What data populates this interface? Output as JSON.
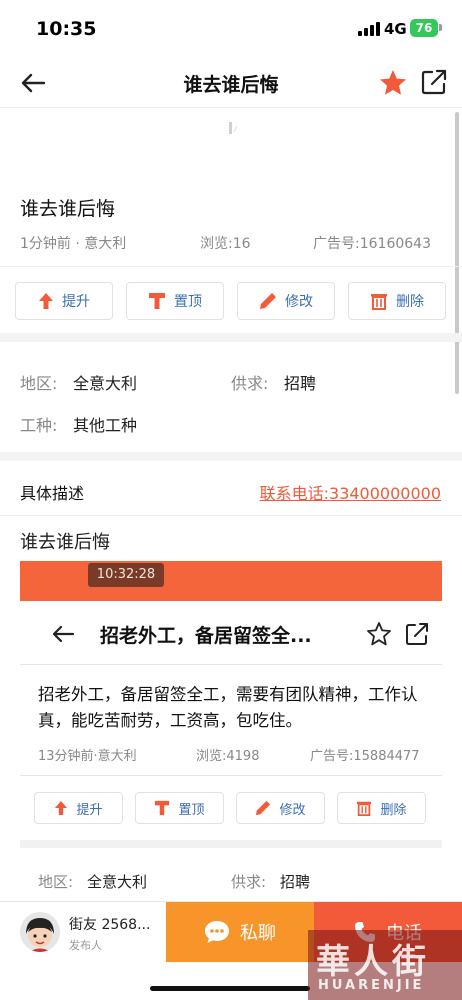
{
  "status_bar": {
    "time": "10:35",
    "network": "4G",
    "battery": "76"
  },
  "nav": {
    "title": "谁去谁后悔"
  },
  "post": {
    "title": "谁去谁后悔",
    "time_location": "1分钟前 · 意大利",
    "views": "浏览:16",
    "ad_number": "广告号:16160643"
  },
  "actions": [
    {
      "label": "提升",
      "icon": "arrow-up-icon"
    },
    {
      "label": "置顶",
      "icon": "pin-top-icon"
    },
    {
      "label": "修改",
      "icon": "pencil-icon"
    },
    {
      "label": "删除",
      "icon": "trash-icon"
    }
  ],
  "details": {
    "region_label": "地区:",
    "region_value": "全意大利",
    "type_label": "供求:",
    "type_value": "招聘",
    "job_label": "工种:",
    "job_value": "其他工种"
  },
  "description": {
    "heading": "具体描述",
    "phone": "联系电话:33400000000",
    "text": "谁去谁后悔"
  },
  "embedded_screenshot": {
    "time_overlay": "10:32:28",
    "nav_title": "招老外工，备居留签全...",
    "body": "招老外工，备居留签全工，需要有团队精神，工作认真，能吃苦耐劳，工资高，包吃住。",
    "time_location": "13分钟前·意大利",
    "views": "浏览:4198",
    "ad_number": "广告号:15884477",
    "actions": [
      "提升",
      "置顶",
      "修改",
      "删除"
    ],
    "region_label": "地区:",
    "region_value": "全意大利",
    "type_label": "供求:",
    "type_value": "招聘"
  },
  "bottom_bar": {
    "user_name": "街友 2568...",
    "user_role": "发布人",
    "chat_label": "私聊",
    "call_label": "电话"
  },
  "watermark": {
    "cn": "華人街",
    "en": "HUARENJIE"
  },
  "colors": {
    "accent": "#f25a3a",
    "orange": "#f8952a",
    "link": "#3a6fb0"
  }
}
